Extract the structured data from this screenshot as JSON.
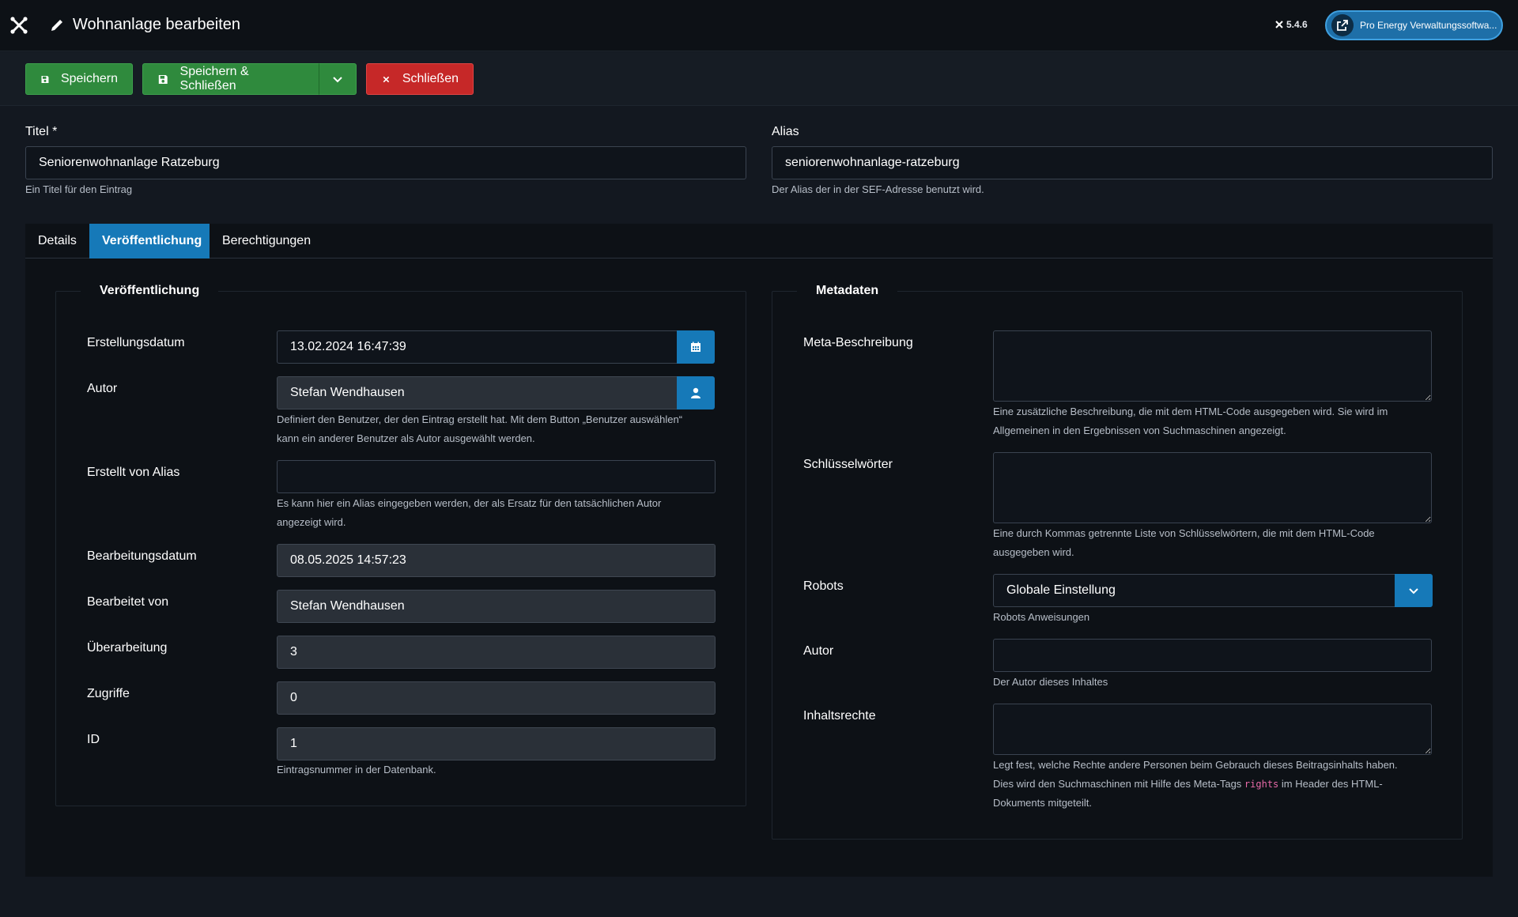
{
  "header": {
    "title": "Wohnanlage bearbeiten",
    "version": "5.4.6",
    "site_button": "Pro Energy Verwaltungssoftwa..."
  },
  "toolbar": {
    "save": "Speichern",
    "save_close": "Speichern & Schließen",
    "close": "Schließen"
  },
  "top": {
    "title_label": "Titel *",
    "title_value": "Seniorenwohnanlage Ratzeburg",
    "title_hint": "Ein Titel für den Eintrag",
    "alias_label": "Alias",
    "alias_value": "seniorenwohnanlage-ratzeburg",
    "alias_hint": "Der Alias der in der SEF-Adresse benutzt wird."
  },
  "tabs": [
    "Details",
    "Veröffentlichung",
    "Berechtigungen"
  ],
  "publishing": {
    "legend": "Veröffentlichung",
    "created_label": "Erstellungsdatum",
    "created_value": "13.02.2024 16:47:39",
    "author_label": "Autor",
    "author_value": "Stefan Wendhausen",
    "author_hint_1": "Definiert den Benutzer, der den Eintrag erstellt hat. Mit dem Button „Benutzer auswählen“",
    "author_hint_2": "kann ein anderer Benutzer als Autor ausgewählt werden.",
    "alias_label": "Erstellt von Alias",
    "alias_value": "",
    "alias_hint_1": "Es kann hier ein Alias eingegeben werden, der als Ersatz für den tatsächlichen Autor",
    "alias_hint_2": "angezeigt wird.",
    "modified_label": "Bearbeitungsdatum",
    "modified_value": "08.05.2025 14:57:23",
    "modified_by_label": "Bearbeitet von",
    "modified_by_value": "Stefan Wendhausen",
    "revision_label": "Überarbeitung",
    "revision_value": "3",
    "hits_label": "Zugriffe",
    "hits_value": "0",
    "id_label": "ID",
    "id_value": "1",
    "id_hint": "Eintragsnummer in der Datenbank."
  },
  "metadata": {
    "legend": "Metadaten",
    "desc_label": "Meta-Beschreibung",
    "desc_hint_1": "Eine zusätzliche Beschreibung, die mit dem HTML-Code ausgegeben wird. Sie wird im",
    "desc_hint_2": "Allgemeinen in den Ergebnissen von Suchmaschinen angezeigt.",
    "keywords_label": "Schlüsselwörter",
    "keywords_hint_1": "Eine durch Kommas getrennte Liste von Schlüsselwörtern, die mit dem HTML-Code",
    "keywords_hint_2": "ausgegeben wird.",
    "robots_label": "Robots",
    "robots_value": "Globale Einstellung",
    "robots_hint": "Robots Anweisungen",
    "author_label": "Autor",
    "author_hint": "Der Autor dieses Inhaltes",
    "rights_label": "Inhaltsrechte",
    "rights_hint_1": "Legt fest, welche Rechte andere Personen beim Gebrauch dieses Beitragsinhalts haben.",
    "rights_hint_2a": "Dies wird den Suchmaschinen mit Hilfe des Meta-Tags ",
    "rights_hint_code": "rights",
    "rights_hint_2b": " im Header des HTML-",
    "rights_hint_3": "Dokuments mitgeteilt."
  },
  "colors": {
    "accent": "#1679b8",
    "save": "#2f8a3d",
    "close": "#c62828"
  }
}
